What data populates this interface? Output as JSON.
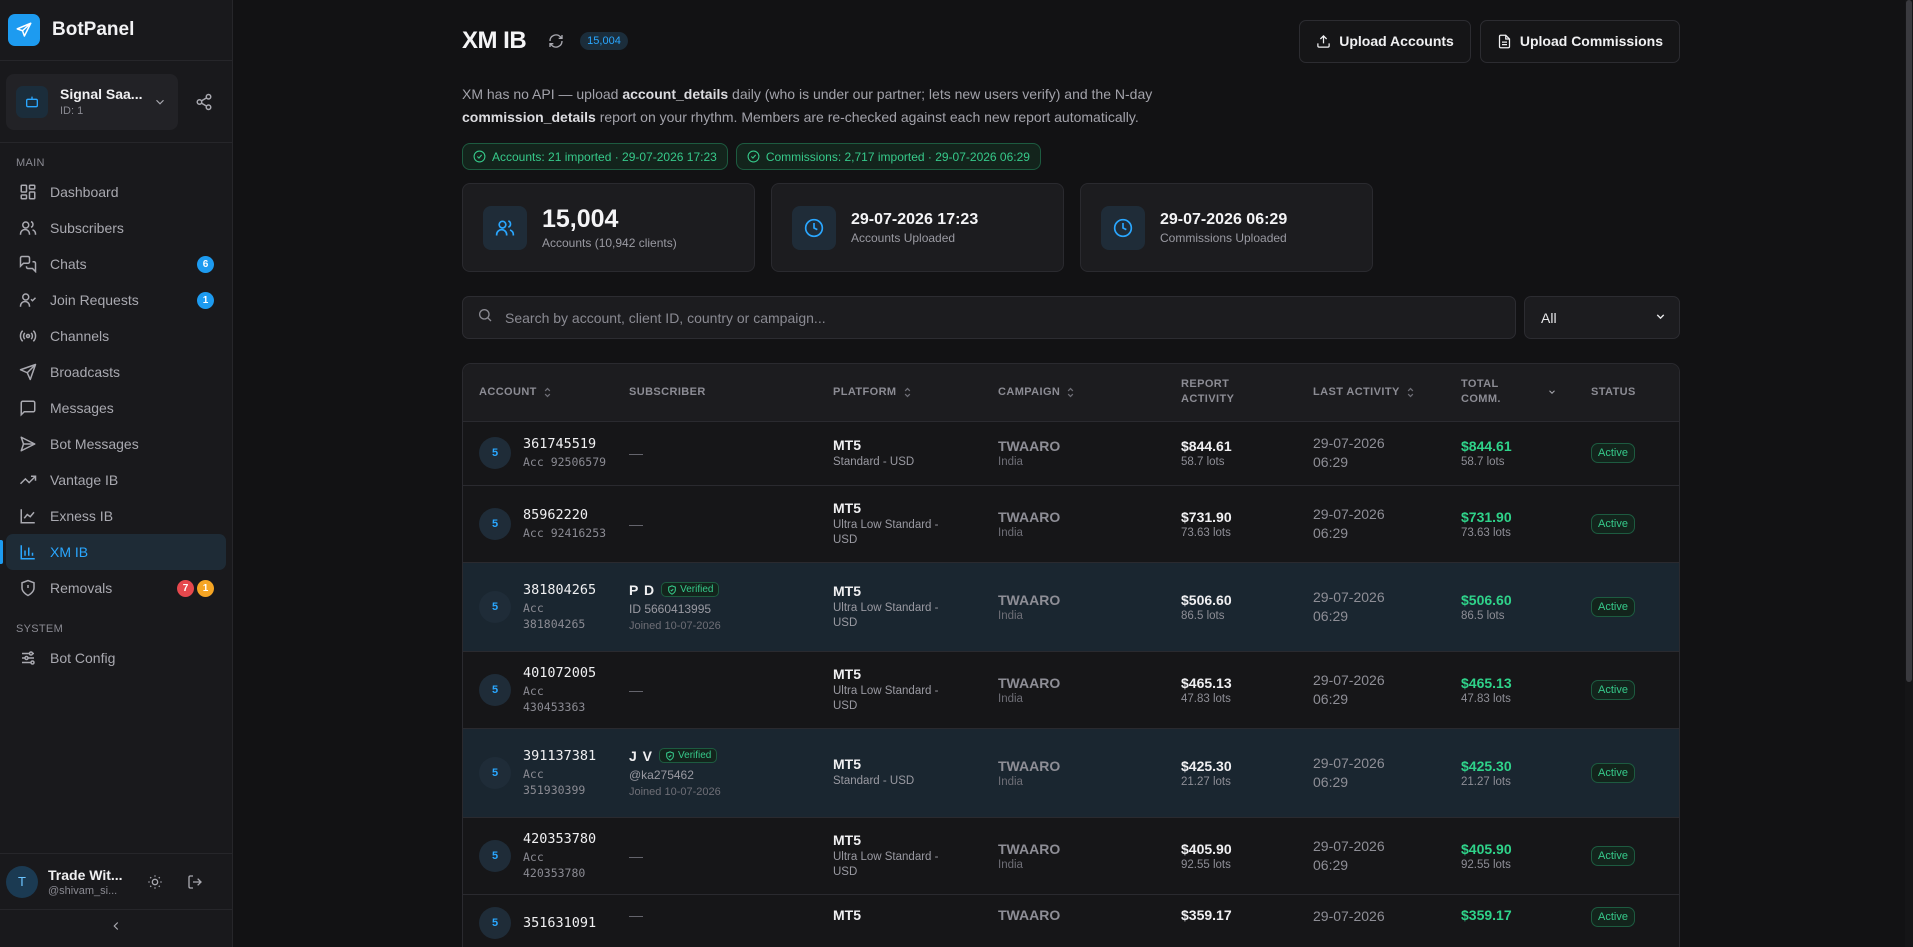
{
  "app": {
    "name": "BotPanel"
  },
  "workspace": {
    "name": "Signal Saa...",
    "id_label": "ID: 1"
  },
  "sidebar": {
    "main_label": "MAIN",
    "system_label": "SYSTEM",
    "items": [
      {
        "label": "Dashboard"
      },
      {
        "label": "Subscribers"
      },
      {
        "label": "Chats",
        "badge": "6"
      },
      {
        "label": "Join Requests",
        "badge": "1"
      },
      {
        "label": "Channels"
      },
      {
        "label": "Broadcasts"
      },
      {
        "label": "Messages"
      },
      {
        "label": "Bot Messages"
      },
      {
        "label": "Vantage IB"
      },
      {
        "label": "Exness IB"
      },
      {
        "label": "XM IB"
      },
      {
        "label": "Removals",
        "badge_red": "7",
        "badge_orange": "1"
      }
    ],
    "system_items": [
      {
        "label": "Bot Config"
      }
    ]
  },
  "user": {
    "initial": "T",
    "name": "Trade Wit...",
    "handle": "@shivam_si..."
  },
  "page": {
    "title": "XM IB",
    "count": "15,004",
    "upload_accounts": "Upload Accounts",
    "upload_commissions": "Upload Commissions",
    "desc": {
      "p1": "XM has no API — upload ",
      "b1": "account_details",
      "p2": " daily (who is under our partner; lets new users verify) and the N-day ",
      "b2": "commission_details",
      "p3": " report on your rhythm. Members are re-checked against each new report automatically."
    },
    "chip_accounts": "Accounts: 21 imported · 29-07-2026 17:23",
    "chip_commissions": "Commissions: 2,717 imported · 29-07-2026 06:29"
  },
  "stats": [
    {
      "value": "15,004",
      "label": "Accounts (10,942 clients)"
    },
    {
      "value": "29-07-2026 17:23",
      "label": "Accounts Uploaded"
    },
    {
      "value": "29-07-2026 06:29",
      "label": "Commissions Uploaded"
    }
  ],
  "search": {
    "placeholder": "Search by account, client ID, country or campaign..."
  },
  "filter": {
    "selected": "All"
  },
  "table": {
    "headers": {
      "account": "ACCOUNT",
      "subscriber": "SUBSCRIBER",
      "platform": "PLATFORM",
      "campaign": "CAMPAIGN",
      "report1": "REPORT",
      "report2": "ACTIVITY",
      "last": "LAST ACTIVITY",
      "total1": "TOTAL",
      "total2": "COMM.",
      "status": "STATUS"
    },
    "rows": [
      {
        "level": "5",
        "account": "361745519",
        "acc_sub": "Acc 92506579",
        "sub_name": "",
        "platform": "MT5",
        "platform_sub": "Standard - USD",
        "campaign": "TWAARO",
        "country": "India",
        "report": "$844.61",
        "report_lots": "58.7 lots",
        "last1": "29-07-2026",
        "last2": "06:29",
        "total": "$844.61",
        "total_lots": "58.7 lots",
        "status": "Active"
      },
      {
        "level": "5",
        "account": "85962220",
        "acc_sub": "Acc 92416253",
        "sub_name": "",
        "platform": "MT5",
        "platform_sub": "Ultra Low Standard - USD",
        "campaign": "TWAARO",
        "country": "India",
        "report": "$731.90",
        "report_lots": "73.63 lots",
        "last1": "29-07-2026",
        "last2": "06:29",
        "total": "$731.90",
        "total_lots": "73.63 lots",
        "status": "Active"
      },
      {
        "level": "5",
        "account": "381804265",
        "acc_sub": "Acc 381804265",
        "sub_name": "P D",
        "verified": "Verified",
        "sub_line": "ID 5660413995",
        "sub_join": "Joined 10-07-2026",
        "platform": "MT5",
        "platform_sub": "Ultra Low Standard - USD",
        "campaign": "TWAARO",
        "country": "India",
        "report": "$506.60",
        "report_lots": "86.5 lots",
        "last1": "29-07-2026",
        "last2": "06:29",
        "total": "$506.60",
        "total_lots": "86.5 lots",
        "status": "Active"
      },
      {
        "level": "5",
        "account": "401072005",
        "acc_sub": "Acc 430453363",
        "sub_name": "",
        "platform": "MT5",
        "platform_sub": "Ultra Low Standard - USD",
        "campaign": "TWAARO",
        "country": "India",
        "report": "$465.13",
        "report_lots": "47.83 lots",
        "last1": "29-07-2026",
        "last2": "06:29",
        "total": "$465.13",
        "total_lots": "47.83 lots",
        "status": "Active"
      },
      {
        "level": "5",
        "account": "391137381",
        "acc_sub": "Acc 351930399",
        "sub_name": "J V",
        "verified": "Verified",
        "sub_line": "@ka275462",
        "sub_join": "Joined 10-07-2026",
        "platform": "MT5",
        "platform_sub": "Standard - USD",
        "campaign": "TWAARO",
        "country": "India",
        "report": "$425.30",
        "report_lots": "21.27 lots",
        "last1": "29-07-2026",
        "last2": "06:29",
        "total": "$425.30",
        "total_lots": "21.27 lots",
        "status": "Active"
      },
      {
        "level": "5",
        "account": "420353780",
        "acc_sub": "Acc 420353780",
        "sub_name": "",
        "platform": "MT5",
        "platform_sub": "Ultra Low Standard - USD",
        "campaign": "TWAARO",
        "country": "India",
        "report": "$405.90",
        "report_lots": "92.55 lots",
        "last1": "29-07-2026",
        "last2": "06:29",
        "total": "$405.90",
        "total_lots": "92.55 lots",
        "status": "Active"
      },
      {
        "level": "5",
        "account": "351631091",
        "acc_sub": "",
        "sub_name": "",
        "platform": "MT5",
        "platform_sub": "",
        "campaign": "TWAARO",
        "country": "",
        "report": "$359.17",
        "report_lots": "",
        "last1": "29-07-2026",
        "last2": "",
        "total": "$359.17",
        "total_lots": "",
        "status": "Active"
      }
    ]
  },
  "colors": {
    "accent": "#1d9bf0",
    "success": "#2fd38a",
    "background": "#121214",
    "danger": "#e5484d",
    "warning": "#f5a524"
  }
}
